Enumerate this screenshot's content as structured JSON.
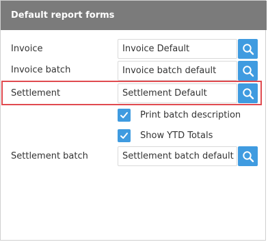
{
  "panel": {
    "title": "Default report forms"
  },
  "rows": [
    {
      "label": "Invoice",
      "value": "Invoice Default"
    },
    {
      "label": "Invoice batch",
      "value": "Invoice batch default"
    },
    {
      "label": "Settlement",
      "value": "Settlement Default"
    },
    {
      "label": "Settlement batch",
      "value": "Settlement batch default"
    }
  ],
  "options": [
    {
      "label": "Print batch description",
      "checked": true
    },
    {
      "label": "Show YTD Totals",
      "checked": true
    }
  ],
  "colors": {
    "header_bg": "#7b7b7b",
    "accent": "#3f9be0",
    "highlight": "#e04a4f"
  },
  "icons": {
    "lookup": "search-icon",
    "checked": "checkmark-icon"
  }
}
